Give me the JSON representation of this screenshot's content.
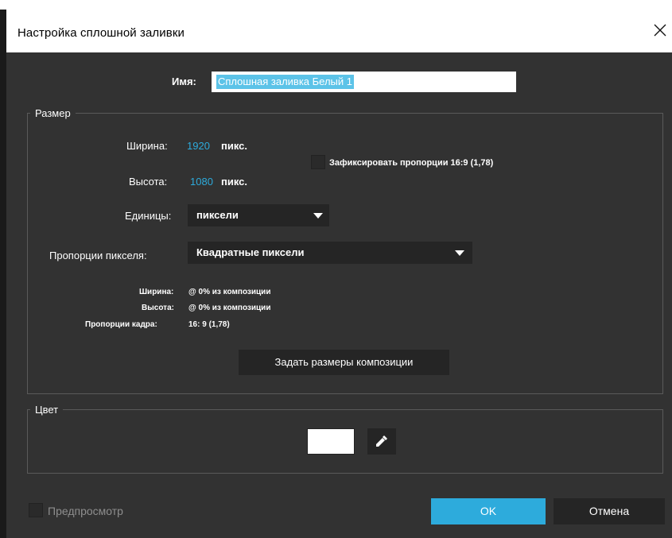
{
  "dialog": {
    "title": "Настройка сплошной заливки",
    "close_icon": "close-icon"
  },
  "name": {
    "label": "Имя:",
    "value": "Сплошная заливка Белый 1"
  },
  "size": {
    "legend": "Размер",
    "width_label": "Ширина:",
    "width_value": "1920",
    "width_unit": "пикс.",
    "height_label": "Высота:",
    "height_value": "1080",
    "height_unit": "пикс.",
    "lock_label": "Зафиксировать пропорции 16:9 (1,78)",
    "lock_checked": false,
    "units_label": "Единицы:",
    "units_value": "пиксели",
    "pixel_aspect_label": "Пропорции пикселя:",
    "pixel_aspect_value": "Квадратные пиксели",
    "info_width_label": "Ширина:",
    "info_width_value": "@ 0% из композиции",
    "info_height_label": "Высота:",
    "info_height_value": "@ 0% из композиции",
    "info_frame_label": "Пропорции кадра:",
    "info_frame_value": "16: 9 (1,78)",
    "make_comp_size_button": "Задать размеры композиции"
  },
  "color": {
    "legend": "Цвет",
    "swatch_color": "#ffffff",
    "eyedropper_icon": "eyedropper-icon"
  },
  "footer": {
    "preview_label": "Предпросмотр",
    "preview_checked": false,
    "ok_label": "OK",
    "cancel_label": "Отмена"
  },
  "colors": {
    "accent": "#2dabdc",
    "panel": "#323232",
    "control": "#252525"
  }
}
